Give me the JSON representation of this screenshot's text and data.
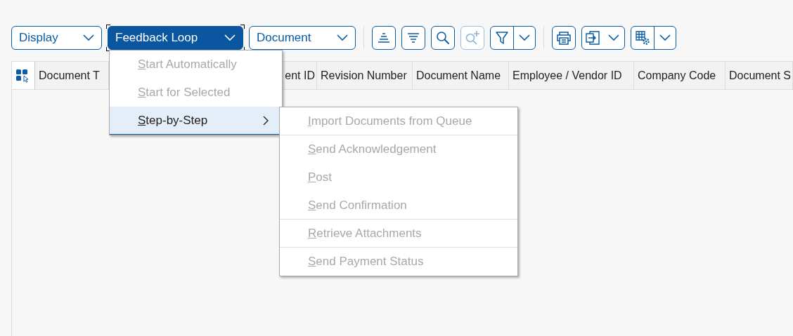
{
  "toolbar": {
    "dropdowns": [
      {
        "label": "Display",
        "open": false
      },
      {
        "label": "Feedback Loop",
        "open": true
      },
      {
        "label": "Document",
        "open": false
      }
    ],
    "tools": [
      {
        "kind": "button",
        "disabled": false
      },
      {
        "kind": "button",
        "disabled": false
      },
      {
        "kind": "button",
        "disabled": false
      },
      {
        "kind": "button",
        "disabled": true
      },
      {
        "kind": "split",
        "disabled": false
      },
      {
        "kind": "separator"
      },
      {
        "kind": "button",
        "disabled": false
      },
      {
        "kind": "menu",
        "disabled": false
      },
      {
        "kind": "split",
        "disabled": false
      }
    ]
  },
  "table": {
    "columns": [
      {
        "label": "Document T",
        "kind": "cell"
      },
      {
        "kind": "hidden"
      },
      {
        "label": "ent ID",
        "kind": "cell"
      },
      {
        "label": "Revision Number",
        "kind": "cell"
      },
      {
        "label": "Document Name",
        "kind": "cell"
      },
      {
        "label": "Employee / Vendor ID",
        "kind": "cell"
      },
      {
        "label": "Company Code",
        "kind": "cell"
      },
      {
        "label": "Document S",
        "kind": "cell"
      }
    ]
  },
  "menu": {
    "items": [
      {
        "label": "Start Automatically",
        "disabled": true,
        "selected": false,
        "submenu": false
      },
      {
        "label": "Start for Selected",
        "disabled": true,
        "selected": false,
        "submenu": false
      },
      {
        "label": "Step-by-Step",
        "disabled": false,
        "selected": true,
        "submenu": true
      }
    ]
  },
  "submenu": {
    "items": [
      {
        "label": "Import Documents from Queue",
        "disabled": true,
        "divider_after": true
      },
      {
        "label": "Send Acknowledgement",
        "disabled": true,
        "divider_after": false
      },
      {
        "label": "Post",
        "disabled": true,
        "divider_after": false
      },
      {
        "label": "Send Confirmation",
        "disabled": true,
        "divider_after": true
      },
      {
        "label": "Retrieve Attachments",
        "disabled": true,
        "divider_after": true
      },
      {
        "label": "Send Payment Status",
        "disabled": true,
        "divider_after": false
      }
    ]
  }
}
